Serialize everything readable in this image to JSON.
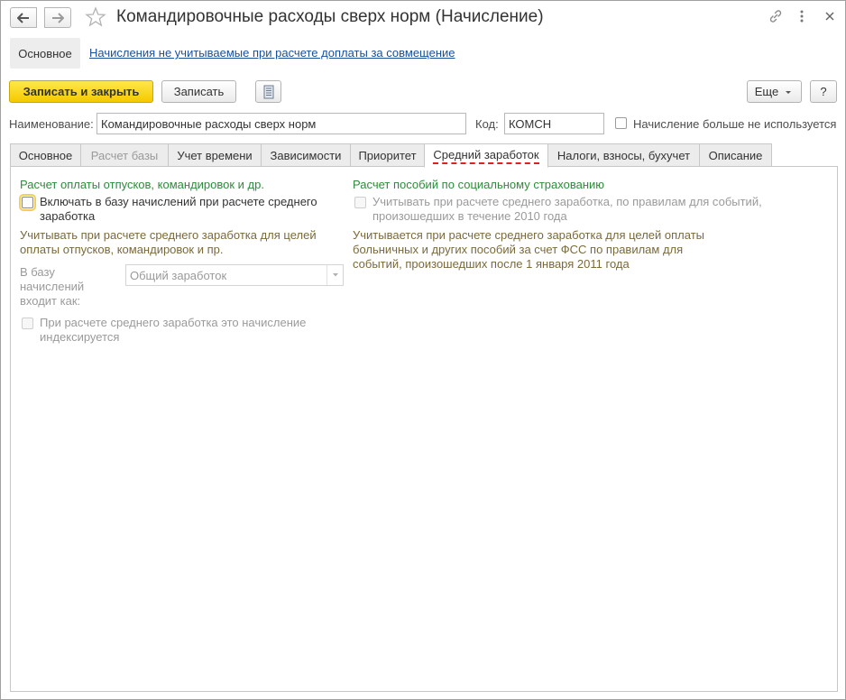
{
  "window": {
    "title": "Командировочные расходы сверх норм (Начисление)"
  },
  "sections": {
    "active": "Основное",
    "link": "Начисления не учитываемые при расчете доплаты за совмещение"
  },
  "toolbar": {
    "save_close": "Записать и закрыть",
    "save": "Записать",
    "more": "Еще",
    "help": "?"
  },
  "fields": {
    "name_label": "Наименование:",
    "name_value": "Командировочные расходы сверх норм",
    "code_label": "Код:",
    "code_value": "КОМСН",
    "not_used_label": "Начисление больше не используется"
  },
  "tabs": [
    {
      "label": "Основное"
    },
    {
      "label": "Расчет базы"
    },
    {
      "label": "Учет времени"
    },
    {
      "label": "Зависимости"
    },
    {
      "label": "Приоритет"
    },
    {
      "label": "Средний заработок"
    },
    {
      "label": "Налоги, взносы, бухучет"
    },
    {
      "label": "Описание"
    }
  ],
  "left": {
    "group_title": "Расчет оплаты отпусков, командировок и др.",
    "include_line1": "Включать в базу начислений при расчете среднего",
    "include_line2": "заработка",
    "note_line1": "Учитывать при расчете среднего заработка для целей",
    "note_line2": "оплаты отпусков, командировок и пр.",
    "base_label_line1": "В базу",
    "base_label_line2": "начислений",
    "base_label_line3": "входит как:",
    "base_select": "Общий заработок",
    "indexed_line1": "При расчете среднего заработка это начисление",
    "indexed_line2": "индексируется"
  },
  "right": {
    "group_title": "Расчет пособий по социальному страхованию",
    "consider_line1": "Учитывать при расчете среднего заработка, по правилам для событий,",
    "consider_line2": "произошедших в течение 2010 года",
    "note_line1": "Учитывается при расчете среднего заработка для целей оплаты",
    "note_line2": "больничных и других пособий за счет ФСС по правилам для",
    "note_line3": "событий, произошедших после 1 января 2011 года"
  },
  "colors": {
    "primary_button": "#f5c900",
    "link": "#1a4f99",
    "group_title": "#2e8b3a",
    "note_text": "#7a6a3a",
    "active_tab_underline": "#e01f1f"
  },
  "icons": [
    "arrow-left-icon",
    "arrow-right-icon",
    "star-icon",
    "link-icon",
    "more-vertical-icon",
    "close-icon",
    "report-icon",
    "chevron-down-icon"
  ]
}
